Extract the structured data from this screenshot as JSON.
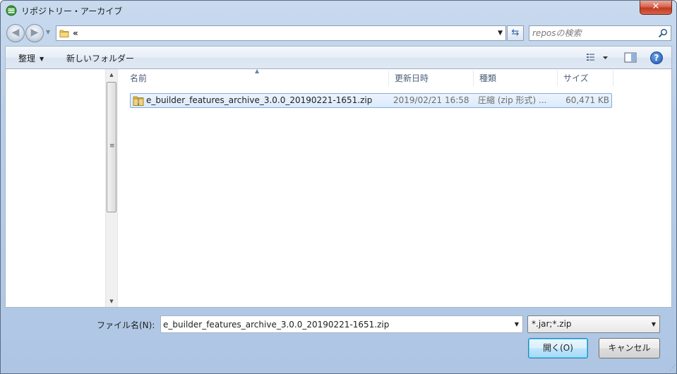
{
  "window": {
    "title": "リポジトリー・アーカイブ",
    "close_label": "✕"
  },
  "nav": {
    "back_glyph": "◀",
    "forward_glyph": "▶",
    "address_text": "«",
    "search_placeholder": "reposの検索"
  },
  "toolbar": {
    "organize_label": "整理",
    "new_folder_label": "新しいフォルダー",
    "help_label": "?"
  },
  "columns": [
    {
      "label": "名前"
    },
    {
      "label": "更新日時"
    },
    {
      "label": "種類"
    },
    {
      "label": "サイズ"
    }
  ],
  "files": [
    {
      "name": "e_builder_features_archive_3.0.0_20190221-1651.zip",
      "modified": "2019/02/21 16:58",
      "type": "圧縮 (zip 形式) ...",
      "size": "60,471 KB"
    }
  ],
  "footer": {
    "filename_label": "ファイル名(N):",
    "filename_value": "e_builder_features_archive_3.0.0_20190221-1651.zip",
    "filter_value": "*.jar;*.zip",
    "open_label": "開く(O)",
    "cancel_label": "キャンセル"
  },
  "icons": {
    "app": "eclipse-icon",
    "folder": "folder-icon",
    "search": "search-icon",
    "zip": "zip-folder-icon",
    "refresh": "refresh-icon",
    "views": "views-icon",
    "preview": "preview-pane-icon",
    "help": "help-icon"
  },
  "colors": {
    "selection_fill": "#dbeafb",
    "selection_border": "#84acdd",
    "header_text": "#4c607a"
  }
}
